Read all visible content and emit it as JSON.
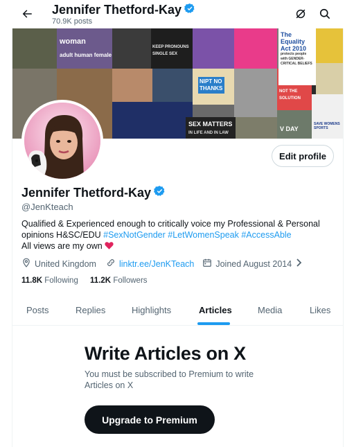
{
  "header": {
    "back_icon": "arrow-left-icon",
    "display_name": "Jennifer Thetford-Kay",
    "post_count": "70.9K posts",
    "grok_icon": "grok-icon",
    "search_icon": "search-icon"
  },
  "banner": {
    "texts": {
      "woman": "woman",
      "adult_human_female": "adult human female",
      "keep_pronouns": "KEEP PRONOUNS SINGLE SEX",
      "equality_title": "The Equality Act 2010",
      "equality_sub": "protects people with GENDER-CRITICAL BELIEFS",
      "assisted": "ASSISTED SUICIDE IS NOT THE SOLUTION",
      "nipt": "NIPT NO THANKS",
      "sex_matters": "SEX MATTERS",
      "sex_matters_sub": "IN LIFE AND IN LAW",
      "vday": "V DAY",
      "save_womens_sports": "SAVE WOMENS SPORTS"
    }
  },
  "profile": {
    "display_name": "Jennifer Thetford-Kay",
    "handle": "@JenKteach",
    "edit_button": "Edit profile",
    "verified_color": "#1d9bf0",
    "bio_text": "Qualified & Experienced enough to critically voice my Professional & Personal opinions H&SC/EDU",
    "hashtags": [
      "#SexNotGender",
      "#LetWomenSpeak",
      "#AccessAble"
    ],
    "bio_line2": "All views are my own",
    "heart_icon": "heart-icon",
    "location": "United Kingdom",
    "link": "linktr.ee/JenKTeach",
    "joined": "Joined August 2014",
    "following_count": "11.8K",
    "following_label": "Following",
    "followers_count": "11.2K",
    "followers_label": "Followers"
  },
  "tabs": [
    {
      "label": "Posts",
      "active": false
    },
    {
      "label": "Replies",
      "active": false
    },
    {
      "label": "Highlights",
      "active": false
    },
    {
      "label": "Articles",
      "active": true
    },
    {
      "label": "Media",
      "active": false
    },
    {
      "label": "Likes",
      "active": false
    }
  ],
  "articles": {
    "title": "Write Articles on X",
    "description": "You must be subscribed to Premium to write Articles on X",
    "button": "Upgrade to Premium"
  },
  "colors": {
    "accent": "#1d9bf0",
    "text": "#0f1419",
    "muted": "#536471",
    "heart": "#f91880"
  }
}
